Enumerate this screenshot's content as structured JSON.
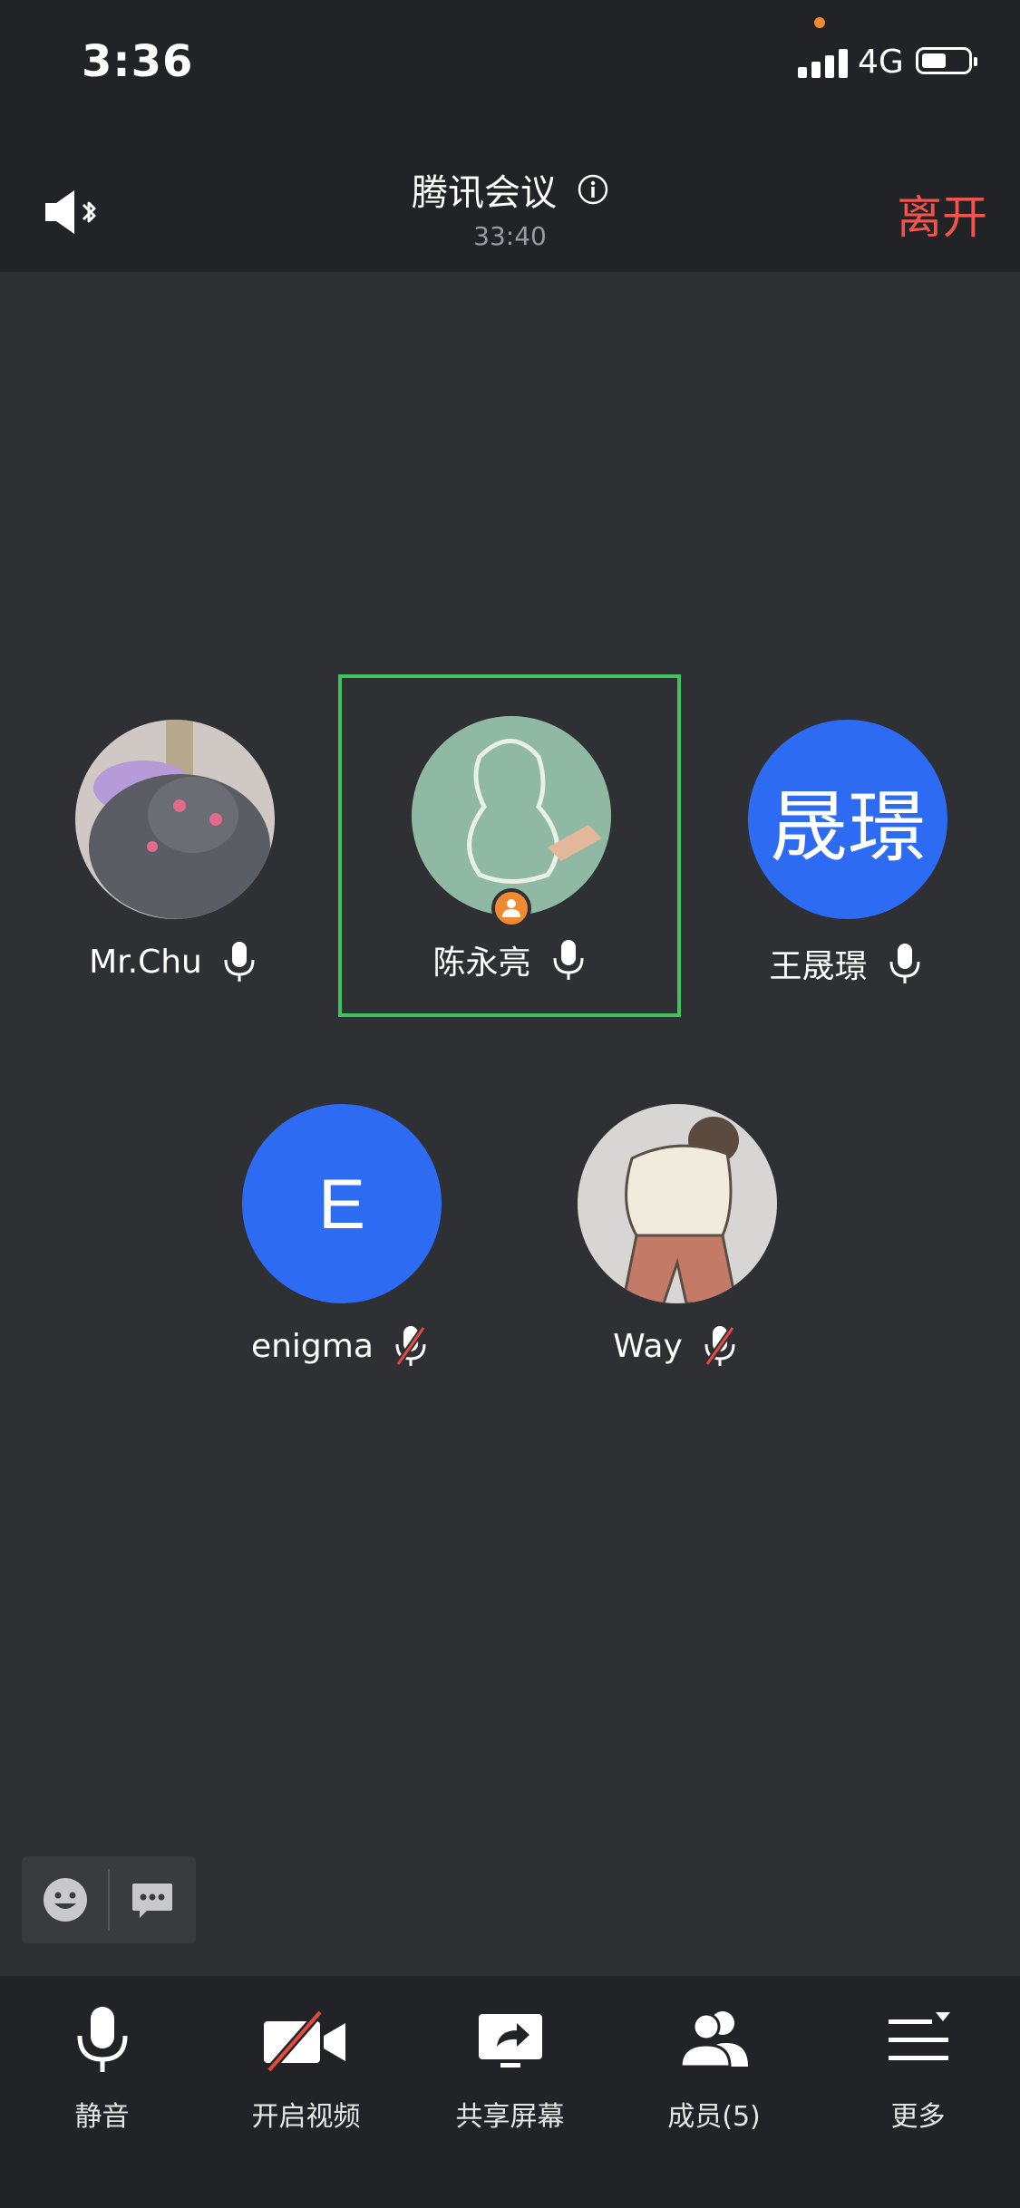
{
  "status_bar": {
    "time": "3:36",
    "network": "4G"
  },
  "header": {
    "title": "腾讯会议",
    "duration": "33:40",
    "leave_label": "离开"
  },
  "participants": [
    {
      "name": "Mr.Chu",
      "mic": "on",
      "avatar": "photo-cat"
    },
    {
      "name": "陈永亮",
      "mic": "on",
      "avatar": "photo-penguin-drawing",
      "host": true,
      "speaking_highlight": true
    },
    {
      "name": "王晟璟",
      "mic": "on",
      "avatar_text": "晟璟",
      "avatar_color": "#2d6bf2"
    },
    {
      "name": "enigma",
      "mic": "muted",
      "avatar_text": "E",
      "avatar_color": "#2d6bf2"
    },
    {
      "name": "Way",
      "mic": "muted",
      "avatar": "photo-sketch-person"
    }
  ],
  "toolbar": {
    "mute_label": "静音",
    "video_label": "开启视频",
    "share_label": "共享屏幕",
    "members_label": "成员(5)",
    "more_label": "更多"
  },
  "colors": {
    "accent_green": "#3fc35e",
    "leave_red": "#f0544c",
    "avatar_blue": "#2d6bf2",
    "host_orange": "#f08a30"
  }
}
